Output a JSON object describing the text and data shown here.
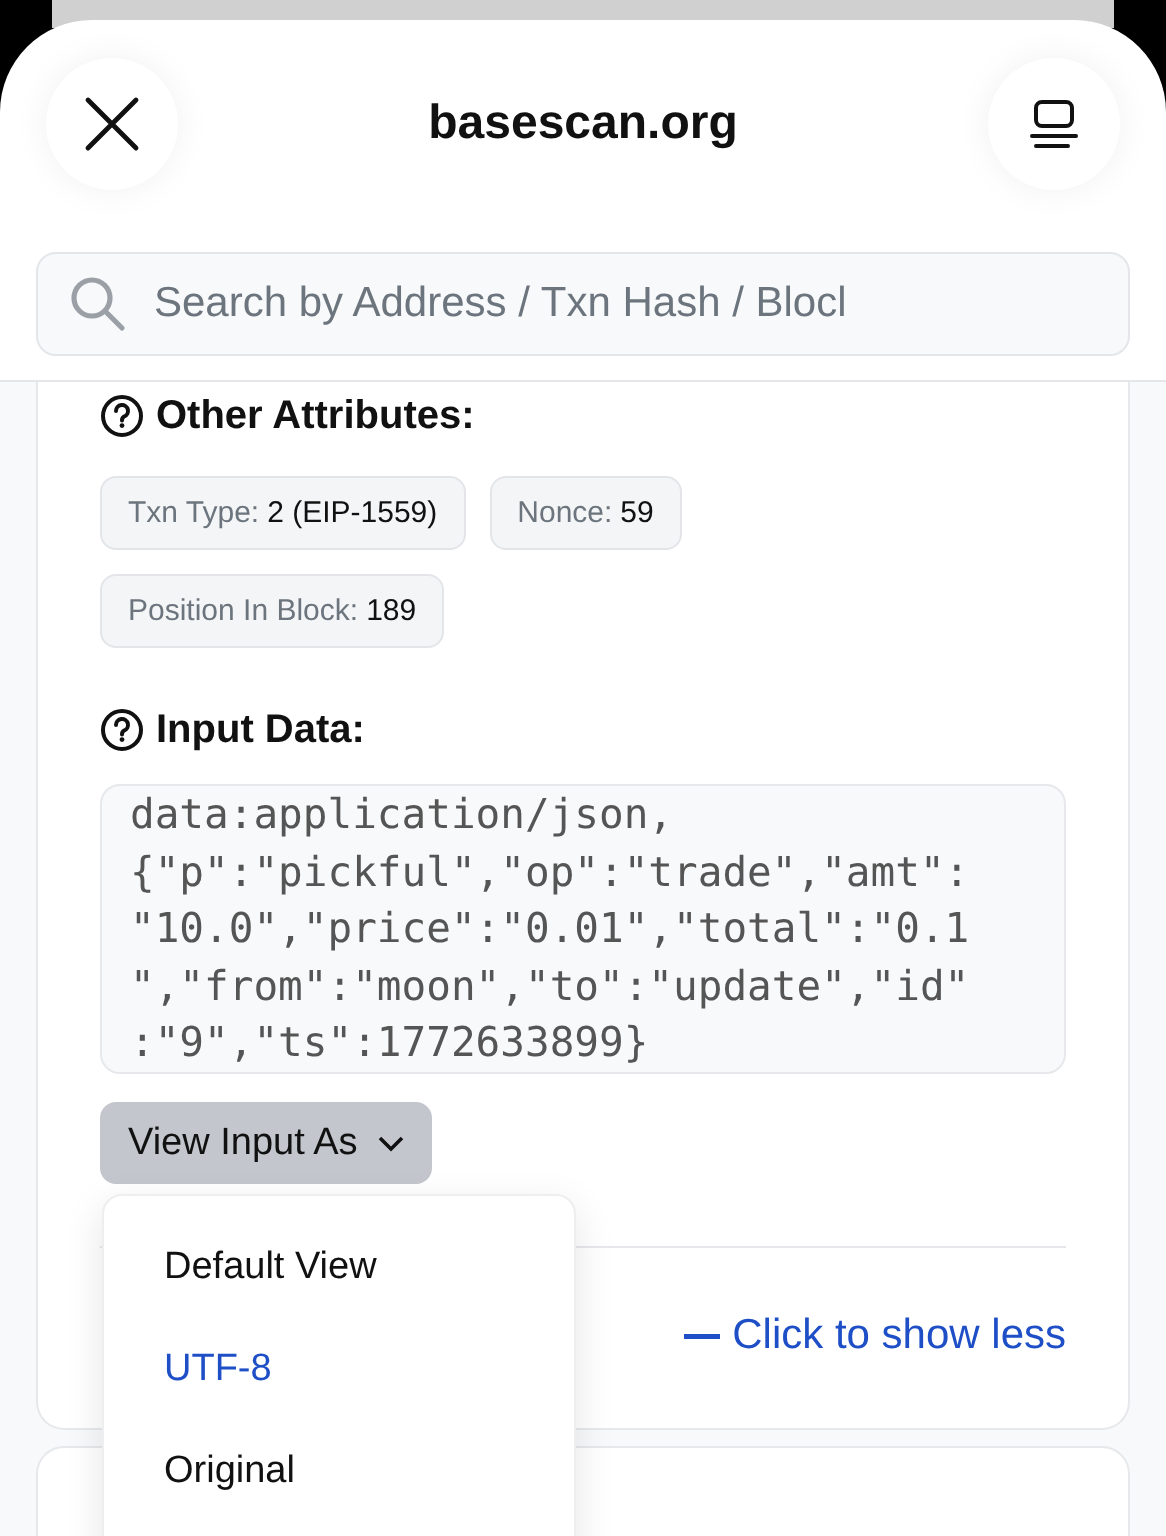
{
  "header": {
    "title": "basescan.org"
  },
  "search": {
    "placeholder": "Search by Address / Txn Hash / Blocl"
  },
  "other_attributes": {
    "heading": "Other Attributes:",
    "chips": [
      {
        "label": "Txn Type:",
        "value": "2 (EIP-1559)"
      },
      {
        "label": "Nonce:",
        "value": "59"
      },
      {
        "label": "Position In Block:",
        "value": "189"
      }
    ]
  },
  "input_data": {
    "heading": "Input Data:",
    "lines": [
      "data:application/json,",
      "{\"p\":\"pickful\",\"op\":\"trade\",\"amt\":",
      "\"10.0\",\"price\":\"0.01\",\"total\":\"0.1",
      "\",\"from\":\"moon\",\"to\":\"update\",\"id\"",
      ":\"9\",\"ts\":1772633899}"
    ]
  },
  "view_input_button": {
    "label": "View Input As"
  },
  "dropdown": {
    "items": [
      {
        "label": "Default View",
        "selected": false
      },
      {
        "label": "UTF-8",
        "selected": true
      },
      {
        "label": "Original",
        "selected": false
      }
    ]
  },
  "show_less_link": {
    "label": "Click to show less"
  }
}
